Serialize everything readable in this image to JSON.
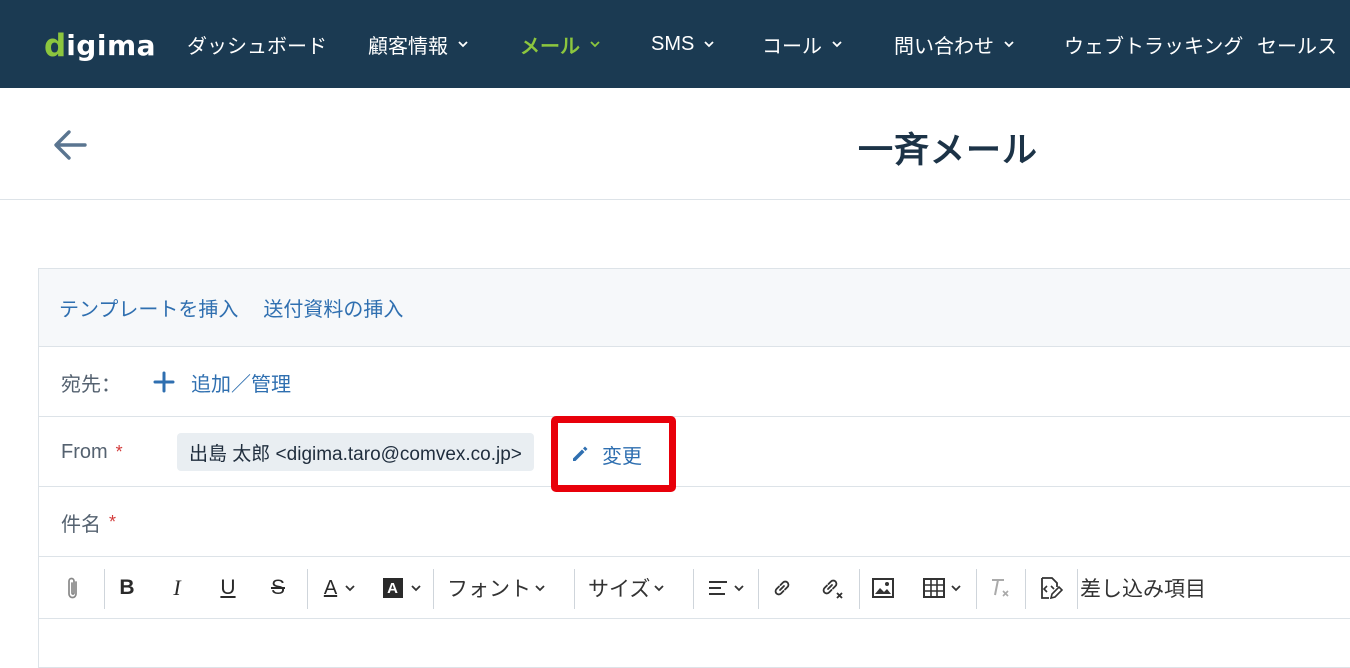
{
  "nav": {
    "logo_first": "d",
    "logo_rest": "igima",
    "items": [
      {
        "label": "ダッシュボード",
        "has_menu": false
      },
      {
        "label": "顧客情報",
        "has_menu": true
      },
      {
        "label": "メール",
        "has_menu": true,
        "active": true
      },
      {
        "label": "SMS",
        "has_menu": true
      },
      {
        "label": "コール",
        "has_menu": true
      },
      {
        "label": "問い合わせ",
        "has_menu": true
      },
      {
        "label": "ウェブトラッキング",
        "has_menu": false
      },
      {
        "label": "セールス",
        "has_menu": false
      }
    ]
  },
  "header": {
    "back_icon": "arrow-left-icon",
    "title": "一斉メール"
  },
  "compose": {
    "toolbar_links": [
      "テンプレートを挿入",
      "送付資料の挿入"
    ],
    "to": {
      "label": "宛先：",
      "add_label": "追加／管理"
    },
    "from": {
      "label": "From",
      "required_mark": "*",
      "value": "出島 太郎 <digima.taro@comvex.co.jp>",
      "change_label": "変更"
    },
    "subject": {
      "label": "件名",
      "required_mark": "*"
    }
  },
  "editor": {
    "bold": "B",
    "italic": "I",
    "underline": "U",
    "strike": "S",
    "font_color": "A",
    "bg_color": "A",
    "font_label": "フォント",
    "size_label": "サイズ",
    "merge_label": "差し込み項目"
  },
  "colors": {
    "nav_bg": "#1b3a52",
    "accent_green": "#8cc63e",
    "link_blue": "#2f6fb0",
    "highlight_red": "#e8000a",
    "required_red": "#d33b3b"
  }
}
